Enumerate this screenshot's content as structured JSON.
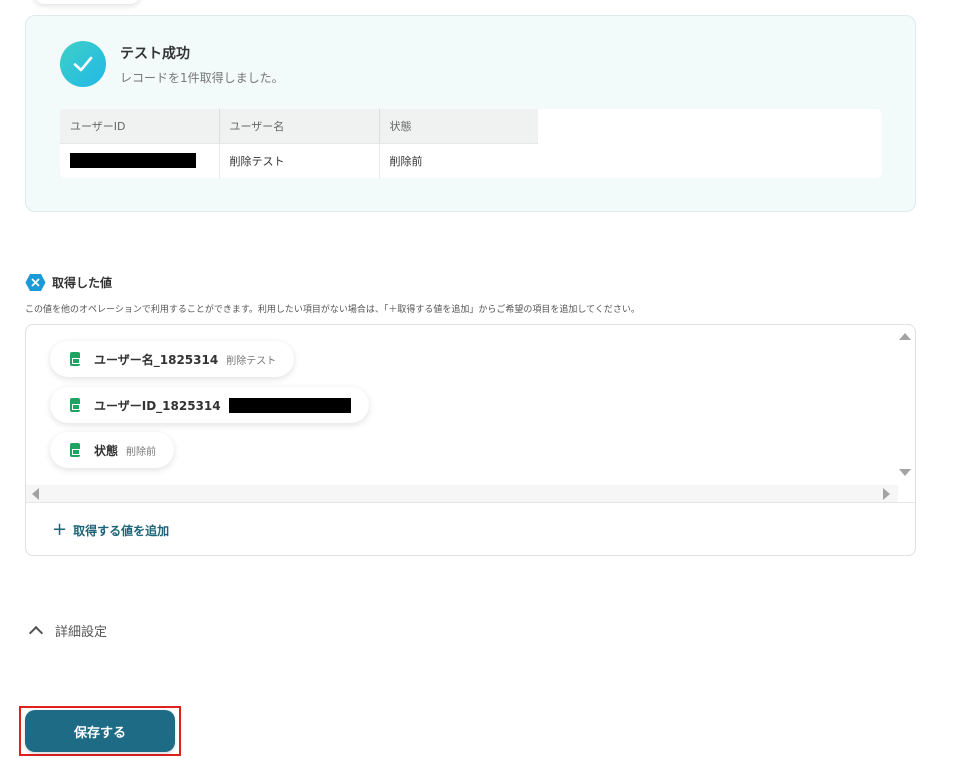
{
  "success": {
    "title": "テスト成功",
    "subtitle": "レコードを1件取得しました。",
    "table": {
      "headers": [
        "ユーザーID",
        "ユーザー名",
        "状態"
      ],
      "rows": [
        {
          "user_id_redacted": true,
          "user_name": "削除テスト",
          "status": "削除前"
        }
      ]
    }
  },
  "acquired": {
    "title": "取得した値",
    "description": "この値を他のオペレーションで利用することができます。利用したい項目がない場合は、「＋取得する値を追加」からご希望の項目を追加してください。",
    "items": [
      {
        "label": "ユーザー名_1825314",
        "value": "削除テスト",
        "redacted": false
      },
      {
        "label": "ユーザーID_1825314",
        "value": "",
        "redacted": true
      },
      {
        "label": "状態",
        "value": "削除前",
        "redacted": false
      }
    ],
    "add_label": "取得する値を追加"
  },
  "advanced": {
    "label": "詳細設定"
  },
  "save": {
    "label": "保存する"
  },
  "colors": {
    "primary": "#1d6b84",
    "accent_text": "#1d6478",
    "success_start": "#3dd0c6",
    "success_end": "#22b8e8",
    "sheet_green": "#1ea362",
    "highlight_red": "#e0201d"
  }
}
